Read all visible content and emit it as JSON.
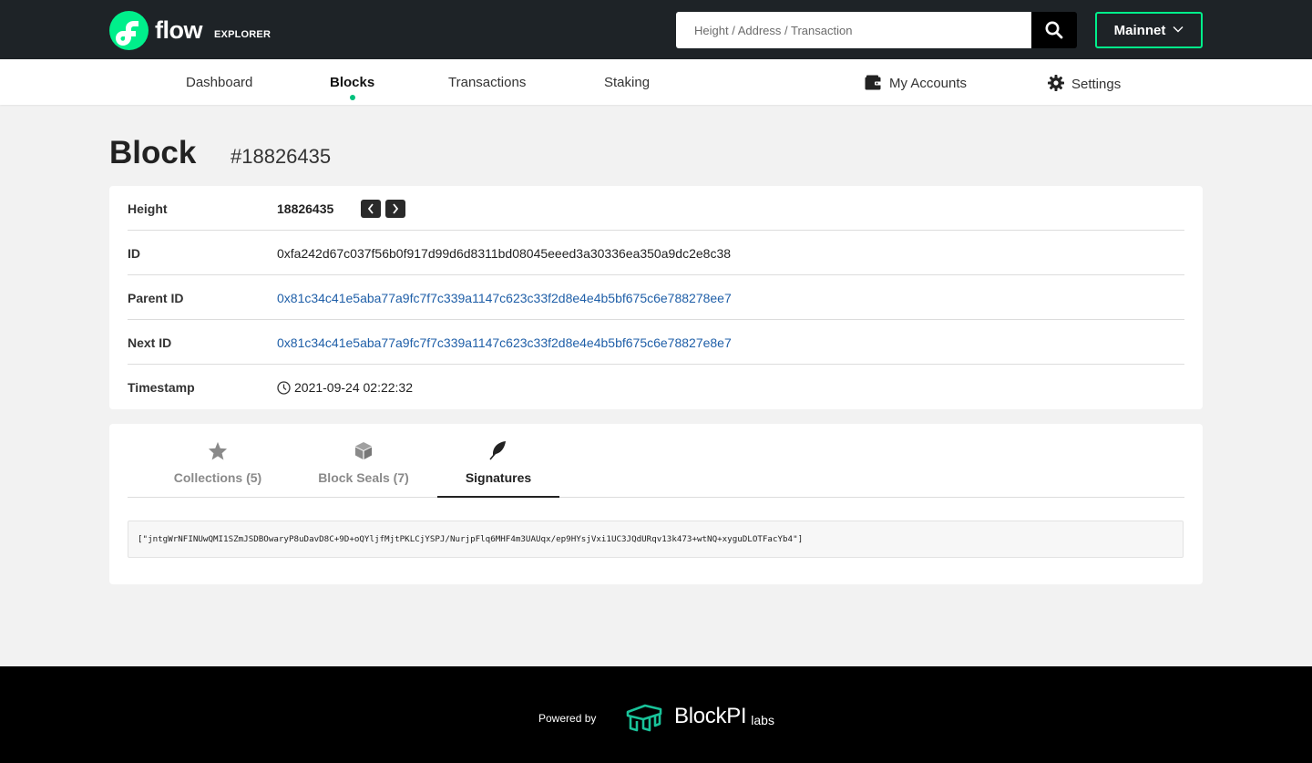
{
  "header": {
    "brand": "flow",
    "brand_sub": "EXPLORER",
    "search_placeholder": "Height / Address / Transaction",
    "network": "Mainnet"
  },
  "nav": {
    "items": [
      {
        "label": "Dashboard"
      },
      {
        "label": "Blocks",
        "active": true
      },
      {
        "label": "Transactions"
      },
      {
        "label": "Staking"
      }
    ],
    "right": [
      {
        "label": "My Accounts",
        "icon": "wallet-icon"
      },
      {
        "label": "Settings",
        "icon": "gear-icon"
      }
    ]
  },
  "page": {
    "title": "Block",
    "subtitle": "#18826435"
  },
  "details": {
    "height_label": "Height",
    "height_value": "18826435",
    "id_label": "ID",
    "id_value": "0xfa242d67c037f56b0f917d99d6d8311bd08045eeed3a30336ea350a9dc2e8c38",
    "parent_label": "Parent ID",
    "parent_value": "0x81c34c41e5aba77a9fc7f7c339a1147c623c33f2d8e4e4b5bf675c6e788278ee7",
    "next_label": "Next ID",
    "next_value": "0x81c34c41e5aba77a9fc7f7c339a1147c623c33f2d8e4e4b5bf675c6e78827e8e7",
    "timestamp_label": "Timestamp",
    "timestamp_value": "2021-09-24 02:22:32"
  },
  "tabs": [
    {
      "label": "Collections (5)",
      "icon": "star-icon"
    },
    {
      "label": "Block Seals (7)",
      "icon": "cube-icon"
    },
    {
      "label": "Signatures",
      "icon": "feather-icon",
      "active": true
    }
  ],
  "signatures": {
    "value": "[\"jntgWrNFINUwQMI1SZmJSDBOwaryP8uDavD8C+9D+oQYljfMjtPKLCjYSPJ/NurjpFlq6MHF4m3UAUqx/ep9HYsjVxi1UC3JQdURqv13k473+wtNQ+xyguDLOTFacYb4\"]"
  },
  "footer": {
    "powered_by": "Powered by",
    "brand": "BlockPI",
    "brand_sub": "labs"
  },
  "colors": {
    "accent": "#00ef8b",
    "header_bg": "#1e2327",
    "link": "#1f5fa8"
  }
}
